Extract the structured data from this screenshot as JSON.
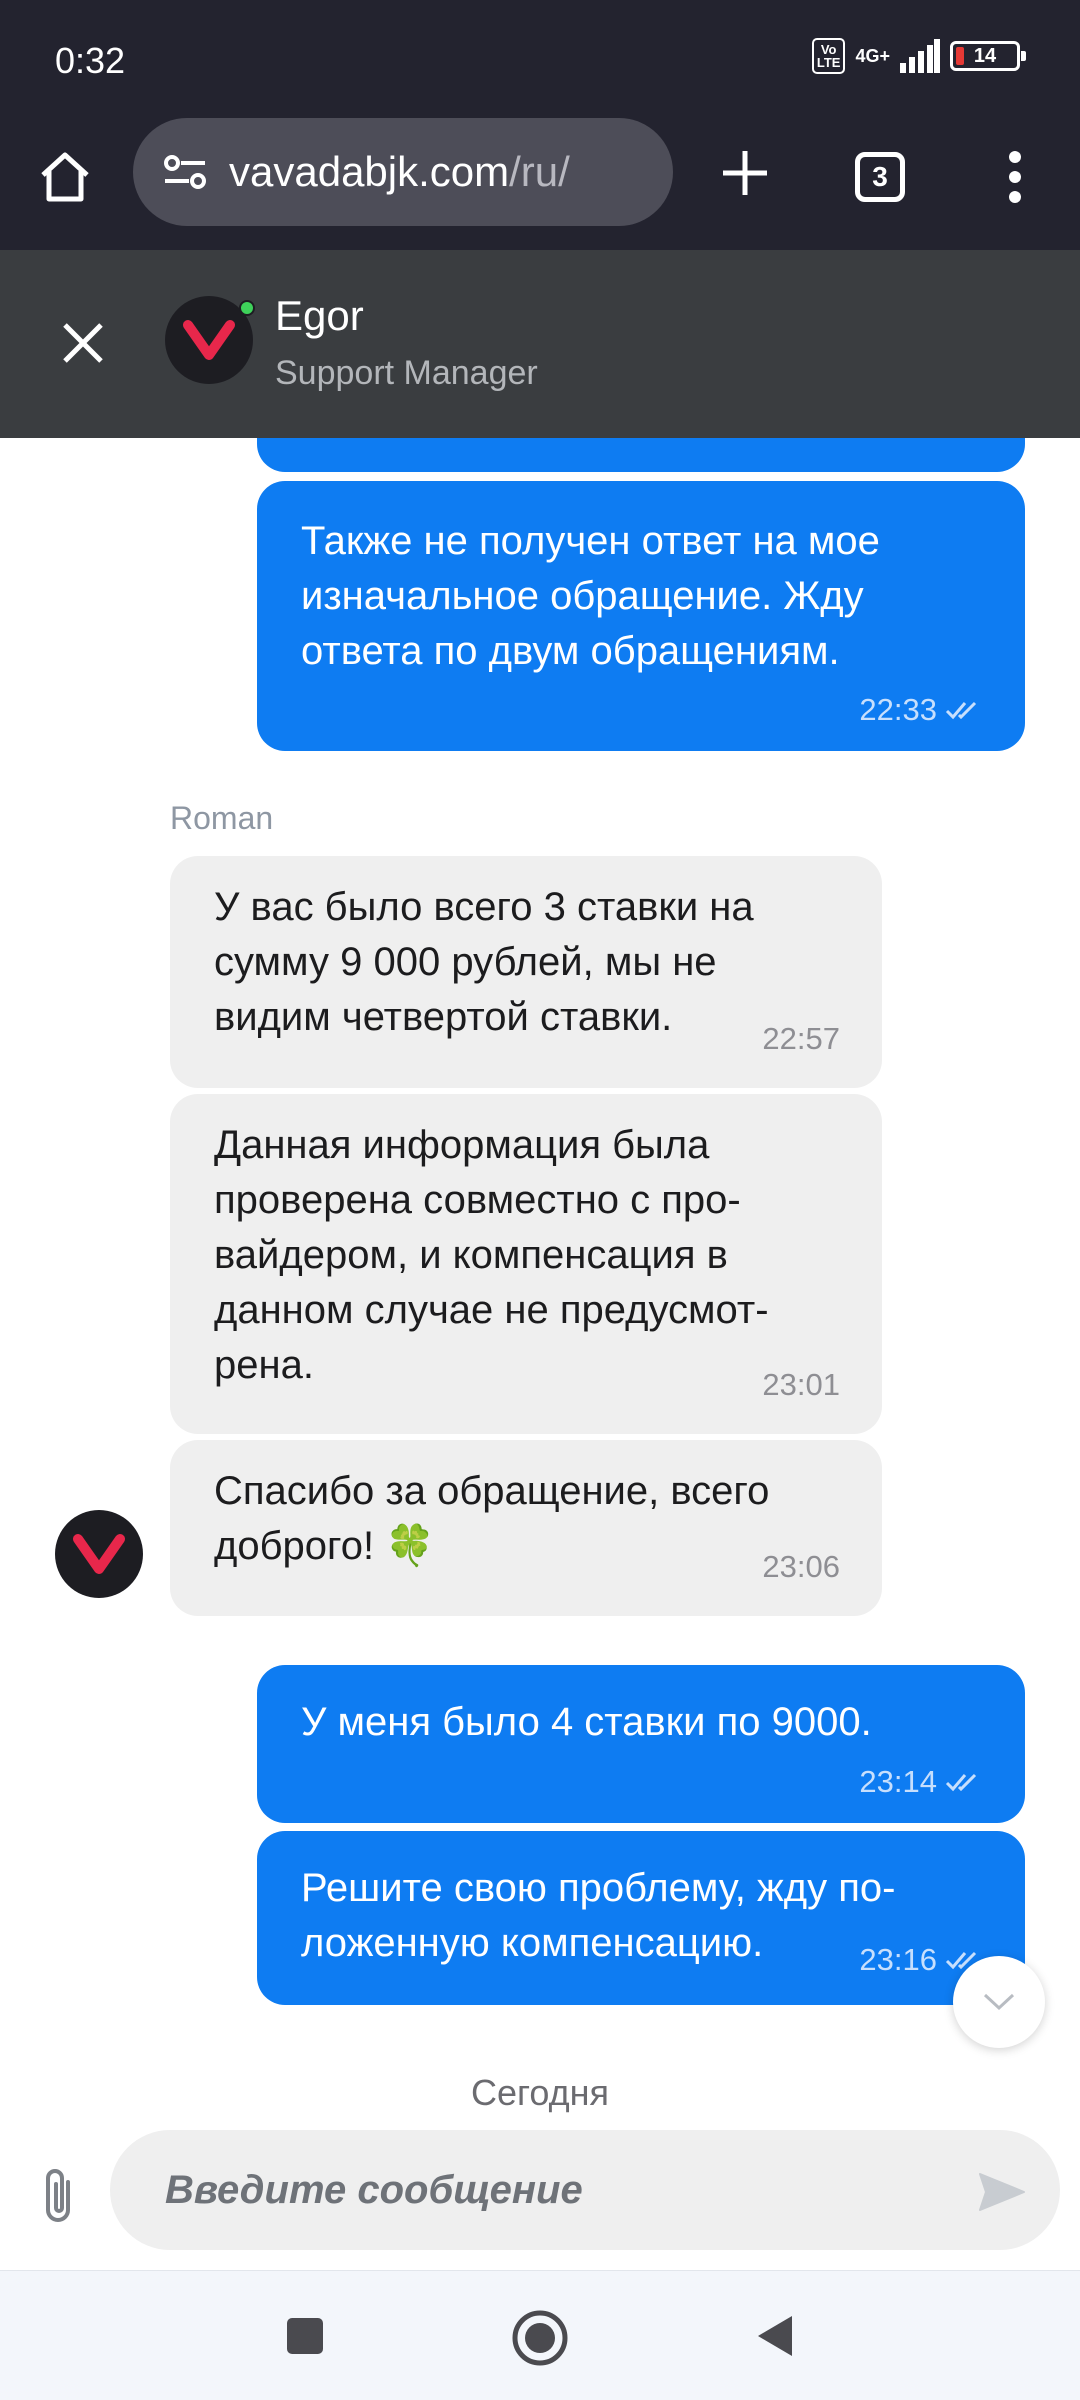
{
  "status_bar": {
    "time": "0:32",
    "volte": "Vo\nLTE",
    "network": "4G+",
    "battery": "14"
  },
  "browser": {
    "url_domain": "vavadabjk.com",
    "url_path": "/ru/",
    "tab_count": "3"
  },
  "chat_header": {
    "agent_name": "Egor",
    "agent_role": "Support Manager"
  },
  "messages": [
    {
      "direction": "out",
      "text": "Также не получен ответ на мое\nизначальное обращение. Жду\nответа по двум обращениям.",
      "time": "22:33"
    },
    {
      "direction": "in",
      "sender": "Roman",
      "text": "У вас было всего 3 ставки на\nсумму 9 000 рублей, мы не\nвидим четвертой ставки.",
      "time": "22:57"
    },
    {
      "direction": "in",
      "text": "Данная информация была\nпроверена совместно с про-\nвайдером, и компенсация в\nданном случае не предусмот-\nрена.",
      "time": "23:01"
    },
    {
      "direction": "in",
      "text": "Спасибо за обращение, всего\nдоброго!",
      "emoji": "🍀",
      "time": "23:06"
    },
    {
      "direction": "out",
      "text": "У меня было 4 ставки по 9000.",
      "time": "23:14"
    },
    {
      "direction": "out",
      "text": "Решите свою проблему, жду по-\nложенную компенсацию.",
      "time": "23:16"
    }
  ],
  "date_separator": "Сегодня",
  "composer": {
    "placeholder": "Введите сообщение"
  },
  "colors": {
    "outgoing_bubble": "#0e7cf2",
    "incoming_bubble": "#efefef",
    "header_bg": "#3a3d40",
    "browser_bg": "#23232f",
    "brand_red": "#e8274b"
  }
}
